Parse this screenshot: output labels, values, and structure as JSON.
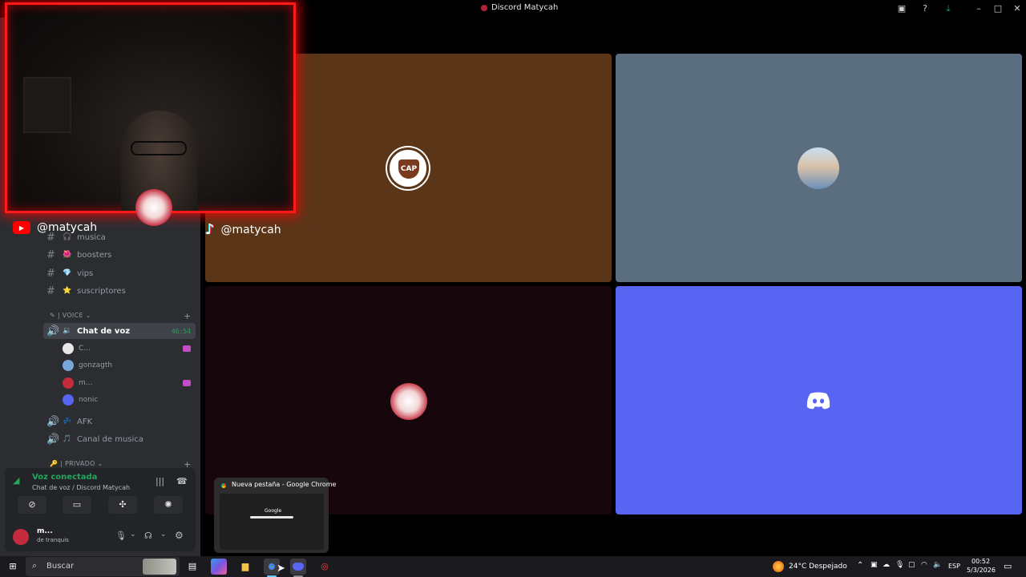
{
  "window": {
    "title": "Discord Matycah"
  },
  "sidebar": {
    "channels": [
      {
        "label": "musica",
        "emoji": "🎧"
      },
      {
        "label": "boosters",
        "emoji": "🌺"
      },
      {
        "label": "vips",
        "emoji": "💎"
      },
      {
        "label": "suscriptores",
        "emoji": "⭐"
      }
    ],
    "voice_category": "| VOICE",
    "voice_channels": {
      "active": {
        "label": "Chat de voz",
        "timer": "46:54"
      },
      "afk": {
        "label": "AFK"
      },
      "music": {
        "label": "Canal de musica"
      }
    },
    "members": [
      {
        "name": "C...",
        "color": "#e8e8e8",
        "live": true
      },
      {
        "name": "gonzagth",
        "color": "#7aa7d9",
        "live": false
      },
      {
        "name": "m...",
        "color": "#c42b3d",
        "live": true
      },
      {
        "name": "nonic",
        "color": "#5865f2",
        "live": false
      }
    ],
    "private_category": "| PRIVADO"
  },
  "voice_panel": {
    "status": "Voz conectada",
    "channel": "Chat de voz / Discord Matycah",
    "user_name": "m...",
    "user_status": "de tranquis"
  },
  "overlay": {
    "youtube_handle": "@matycah",
    "tiktok_handle": "@matycah"
  },
  "stage": {
    "tiles": [
      {
        "id": "cap",
        "bg": "#5a3518",
        "avatar_text": "CAP"
      },
      {
        "id": "gonzagth",
        "bg": "#5b6e80"
      },
      {
        "id": "matycah",
        "bg": "#17060c"
      },
      {
        "id": "nonic",
        "bg": "#5865f2"
      }
    ]
  },
  "chrome_preview": {
    "title": "Nueva pestaña - Google Chrome",
    "logo": "Google"
  },
  "taskbar": {
    "search_placeholder": "Buscar",
    "weather": "24°C Despejado",
    "language": "ESP",
    "time": "00:52",
    "date": "5/3/2026"
  }
}
